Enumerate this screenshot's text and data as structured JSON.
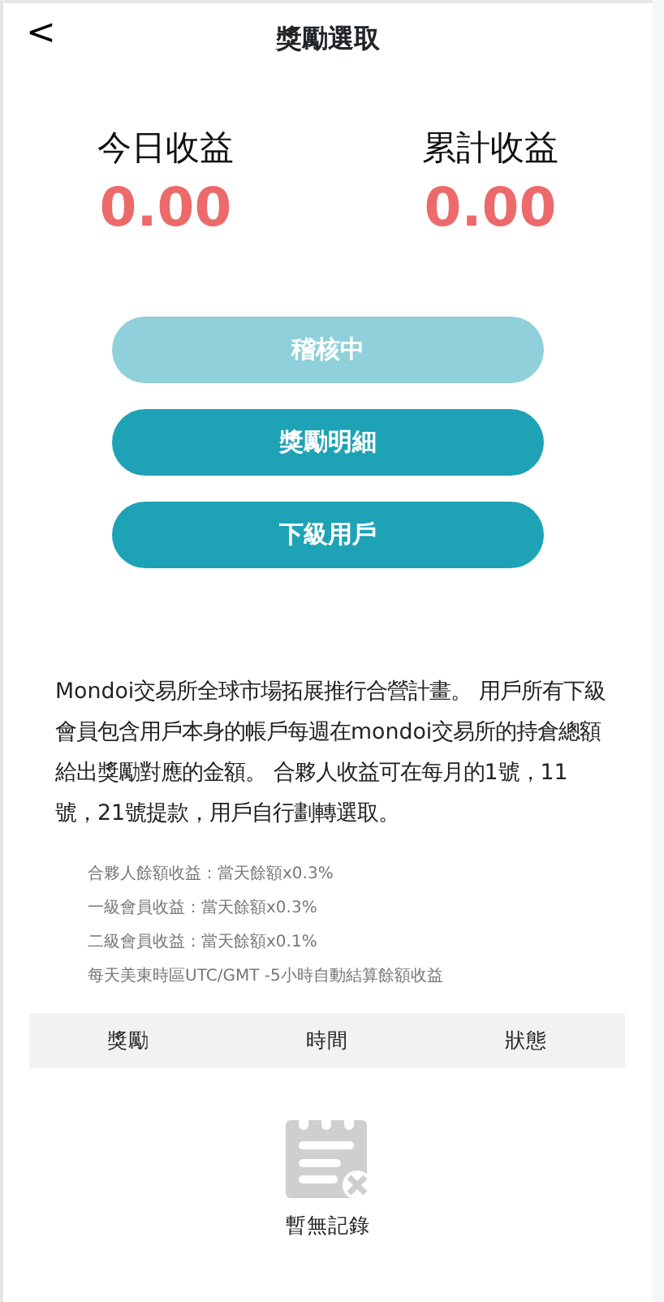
{
  "header": {
    "back": "<",
    "title": "獎勵選取"
  },
  "stats": [
    {
      "label": "今日收益",
      "value": "0.00"
    },
    {
      "label": "累計收益",
      "value": "0.00"
    }
  ],
  "buttons": [
    {
      "label": "稽核中",
      "disabled": true
    },
    {
      "label": "獎勵明細",
      "disabled": false
    },
    {
      "label": "下級用戶",
      "disabled": false
    }
  ],
  "description": "Mondoi交易所全球市場拓展推行合營計畫。 用戶所有下級會員包含用戶本身的帳戶每週在mondoi交易所的持倉總額給出獎勵對應的金額。 合夥人收益可在每月的1號，11號，21號提款，用戶自行劃轉選取。",
  "rules": [
    "合夥人餘額收益：當天餘額x0.3%",
    "一級會員收益：當天餘額x0.3%",
    "二級會員收益：當天餘額x0.1%",
    "每天美東時區UTC/GMT -5小時自動結算餘額收益"
  ],
  "table": {
    "columns": [
      "獎勵",
      "時間",
      "狀態"
    ],
    "empty_text": "暫無記錄"
  }
}
